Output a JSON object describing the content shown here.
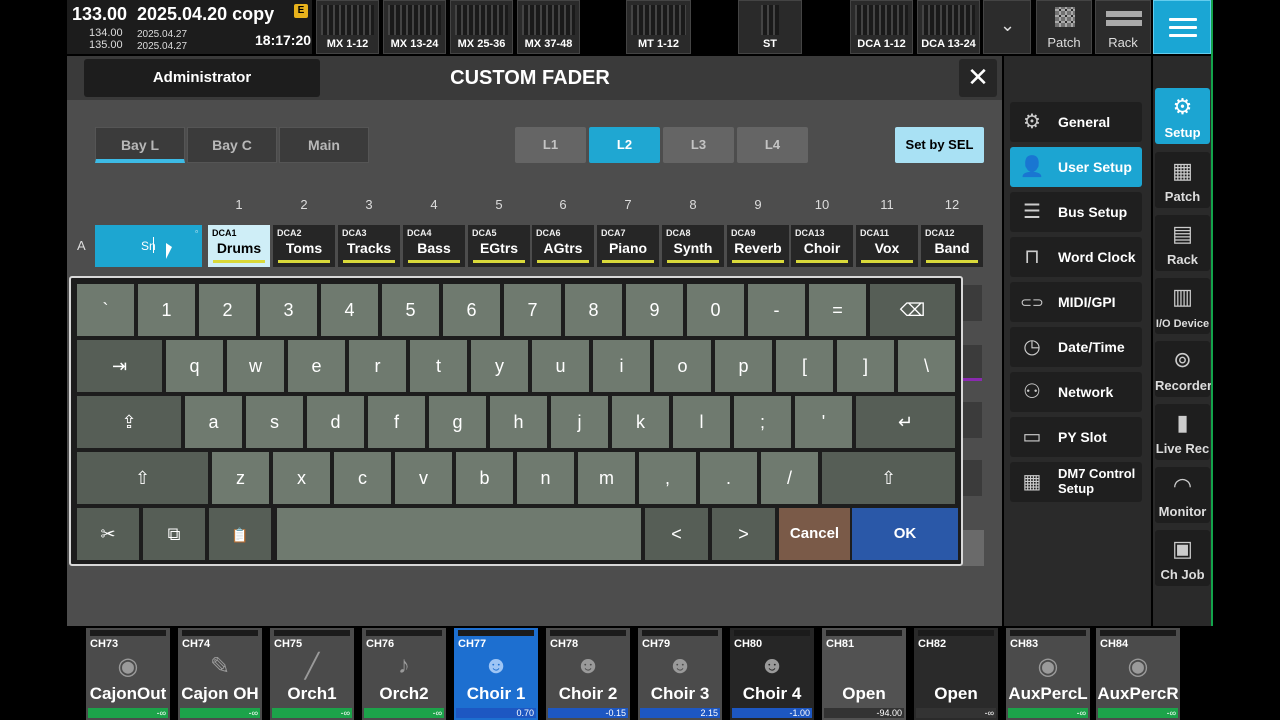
{
  "header": {
    "scene_number": "133.00",
    "scene_title": "2025.04.20 copy",
    "scene_badge": "E",
    "prev_scene_number": "134.00",
    "prev_scene_date": "2025.04.27",
    "next_scene_number": "135.00",
    "next_scene_date": "2025.04.27",
    "clock": "18:17:20",
    "fader_banks": [
      "MX 1-12",
      "MX 13-24",
      "MX 25-36",
      "MX 37-48",
      "MT 1-12",
      "ST",
      "DCA 1-12",
      "DCA 13-24"
    ],
    "patch_label": "Patch",
    "rack_label": "Rack"
  },
  "dialog": {
    "user": "Administrator",
    "title": "CUSTOM FADER",
    "close": "✕",
    "bays": [
      "Bay L",
      "Bay C",
      "Main"
    ],
    "layers": [
      "L1",
      "L2",
      "L3",
      "L4"
    ],
    "set_by_sel": "Set by SEL",
    "row_label": "A",
    "column_numbers": [
      "1",
      "2",
      "3",
      "4",
      "5",
      "6",
      "7",
      "8",
      "9",
      "10",
      "11",
      "12"
    ],
    "active_input": "Sn",
    "slots": [
      {
        "dca": "DCA1",
        "name": "Drums"
      },
      {
        "dca": "DCA2",
        "name": "Toms"
      },
      {
        "dca": "DCA3",
        "name": "Tracks"
      },
      {
        "dca": "DCA4",
        "name": "Bass"
      },
      {
        "dca": "DCA5",
        "name": "EGtrs"
      },
      {
        "dca": "DCA6",
        "name": "AGtrs"
      },
      {
        "dca": "DCA7",
        "name": "Piano"
      },
      {
        "dca": "DCA8",
        "name": "Synth"
      },
      {
        "dca": "DCA9",
        "name": "Reverb"
      },
      {
        "dca": "DCA13",
        "name": "Choir"
      },
      {
        "dca": "DCA11",
        "name": "Vox"
      },
      {
        "dca": "DCA12",
        "name": "Band"
      }
    ]
  },
  "keyboard": {
    "row1": [
      "`",
      "1",
      "2",
      "3",
      "4",
      "5",
      "6",
      "7",
      "8",
      "9",
      "0",
      "-",
      "=",
      "⌫"
    ],
    "row2": [
      "⇥",
      "q",
      "w",
      "e",
      "r",
      "t",
      "y",
      "u",
      "i",
      "o",
      "p",
      "[",
      "]",
      "\\"
    ],
    "row3": [
      "⇪",
      "a",
      "s",
      "d",
      "f",
      "g",
      "h",
      "j",
      "k",
      "l",
      ";",
      "'",
      "↵"
    ],
    "row4": [
      "⇧",
      "z",
      "x",
      "c",
      "v",
      "b",
      "n",
      "m",
      ",",
      ".",
      "/",
      "⇧"
    ],
    "cut": "✂",
    "copy": "⧉",
    "paste": "📋",
    "left": "<",
    "right": ">",
    "cancel": "Cancel",
    "ok": "OK"
  },
  "setup_menu": [
    {
      "icon": "gear-icon",
      "glyph": "⚙",
      "label": "General"
    },
    {
      "icon": "user-icon",
      "glyph": "👤",
      "label": "User Setup"
    },
    {
      "icon": "bus-icon",
      "glyph": "☰",
      "label": "Bus Setup"
    },
    {
      "icon": "wordclock-icon",
      "glyph": "⊓",
      "label": "Word Clock"
    },
    {
      "icon": "midi-icon",
      "glyph": "⊂⊃",
      "label": "MIDI/GPI"
    },
    {
      "icon": "clock-icon",
      "glyph": "◷",
      "label": "Date/Time"
    },
    {
      "icon": "network-icon",
      "glyph": "⚇",
      "label": "Network"
    },
    {
      "icon": "pyslot-icon",
      "glyph": "▭",
      "label": "PY Slot"
    },
    {
      "icon": "dm7-icon",
      "glyph": "▦",
      "label": "DM7 Control Setup"
    }
  ],
  "right_nav": [
    {
      "label": "Setup",
      "glyph": "⚙"
    },
    {
      "label": "Patch",
      "glyph": "▦"
    },
    {
      "label": "Rack",
      "glyph": "▤"
    },
    {
      "label": "I/O Device",
      "glyph": "▥"
    },
    {
      "label": "Recorder",
      "glyph": "⊚"
    },
    {
      "label": "Live Rec",
      "glyph": "▮"
    },
    {
      "label": "Monitor",
      "glyph": "◠"
    },
    {
      "label": "Ch Job",
      "glyph": "▣"
    }
  ],
  "channels": [
    {
      "id": "CH73",
      "name": "CajonOut",
      "level": "-∞"
    },
    {
      "id": "CH74",
      "name": "Cajon OH",
      "level": "-∞"
    },
    {
      "id": "CH75",
      "name": "Orch1",
      "level": "-∞"
    },
    {
      "id": "CH76",
      "name": "Orch2",
      "level": "-∞"
    },
    {
      "id": "CH77",
      "name": "Choir 1",
      "level": "0.70"
    },
    {
      "id": "CH78",
      "name": "Choir 2",
      "level": "-0.15"
    },
    {
      "id": "CH79",
      "name": "Choir 3",
      "level": "2.15"
    },
    {
      "id": "CH80",
      "name": "Choir 4",
      "level": "-1.00"
    },
    {
      "id": "CH81",
      "name": "Open",
      "level": "-94.00"
    },
    {
      "id": "CH82",
      "name": "Open",
      "level": "-∞"
    },
    {
      "id": "CH83",
      "name": "AuxPercL",
      "level": "-∞"
    },
    {
      "id": "CH84",
      "name": "AuxPercR",
      "level": "-∞"
    }
  ]
}
